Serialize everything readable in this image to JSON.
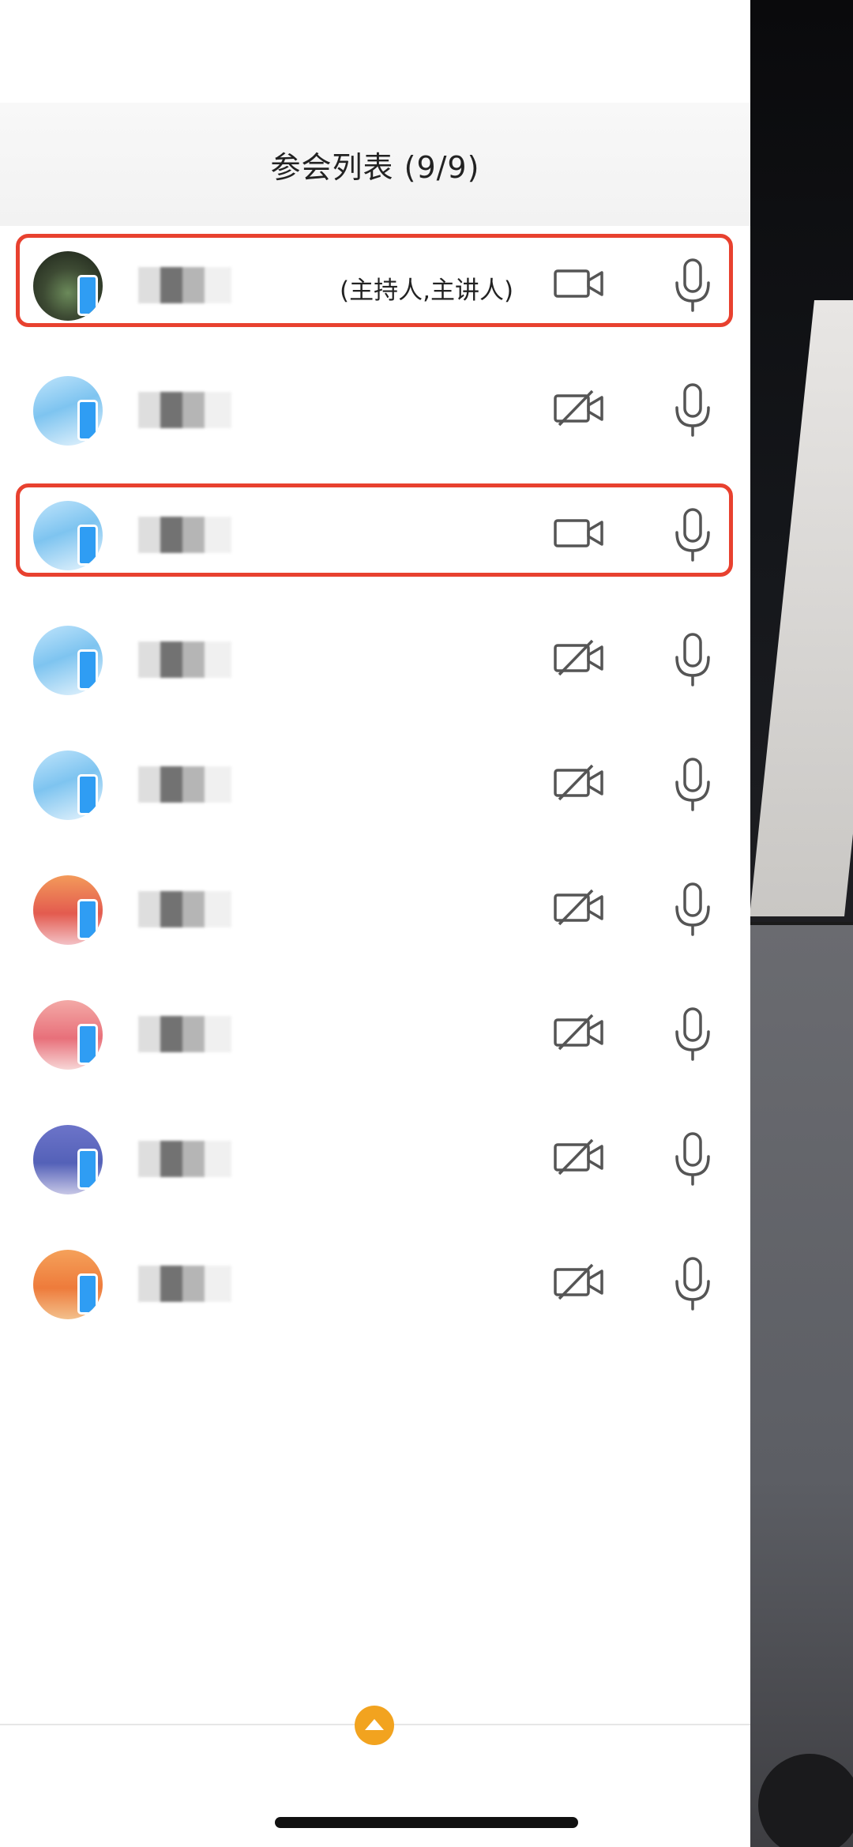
{
  "header": {
    "title": "参会列表 (9/9)"
  },
  "participants": [
    {
      "host_tag": "(主持人,主讲人)",
      "camera": "on",
      "avatar": "photo",
      "highlighted": true
    },
    {
      "host_tag": "",
      "camera": "off",
      "avatar": "sky",
      "highlighted": false
    },
    {
      "host_tag": "",
      "camera": "on",
      "avatar": "sky",
      "highlighted": true
    },
    {
      "host_tag": "",
      "camera": "off",
      "avatar": "sky",
      "highlighted": false
    },
    {
      "host_tag": "",
      "camera": "off",
      "avatar": "sky",
      "highlighted": false
    },
    {
      "host_tag": "",
      "camera": "off",
      "avatar": "sunset",
      "highlighted": false
    },
    {
      "host_tag": "",
      "camera": "off",
      "avatar": "lighthouse",
      "highlighted": false
    },
    {
      "host_tag": "",
      "camera": "off",
      "avatar": "night",
      "highlighted": false
    },
    {
      "host_tag": "",
      "camera": "off",
      "avatar": "desert",
      "highlighted": false
    }
  ],
  "colors": {
    "highlight_border": "#e8412f",
    "accent": "#f2a31f",
    "device_badge": "#2f9df3"
  },
  "icons": {
    "camera_on": "video-camera-icon",
    "camera_off": "video-camera-off-icon",
    "mic": "microphone-icon",
    "expand": "chevron-up-icon"
  }
}
